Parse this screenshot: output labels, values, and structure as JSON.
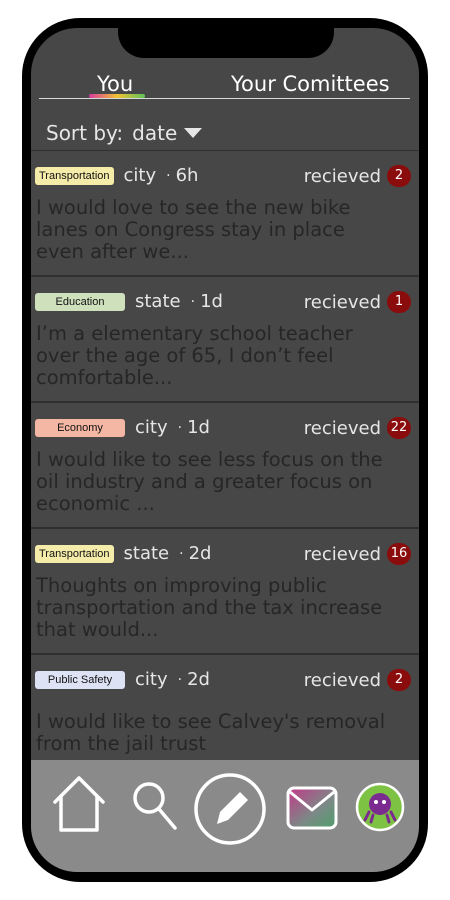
{
  "tabs": {
    "you": "You",
    "committees": "Your Comittees"
  },
  "sort": {
    "label": "Sort by:",
    "value": "date"
  },
  "messages": [
    {
      "tag": "Transportation",
      "tag_color": "#f5ecaa",
      "scope": "city",
      "age": "6h",
      "status": "recieved",
      "count": "2",
      "text": "I would love to see the new bike lanes on Congress stay in place even after we..."
    },
    {
      "tag": "Education",
      "tag_color": "#cfe0bd",
      "scope": "state",
      "age": "1d",
      "status": "recieved",
      "count": "1",
      "text": "I’m a elementary school teacher over the age of 65, I don’t feel comfortable..."
    },
    {
      "tag": "Economy",
      "tag_color": "#f4b7a3",
      "scope": "city",
      "age": "1d",
      "status": "recieved",
      "count": "22",
      "text": "I would like to see less focus on the oil industry and a greater focus on economic ..."
    },
    {
      "tag": "Transportation",
      "tag_color": "#f5ecaa",
      "scope": "state",
      "age": "2d",
      "status": "recieved",
      "count": "16",
      "text": "Thoughts on improving public transportation and the tax increase that would..."
    },
    {
      "tag": "Public Safety",
      "tag_color": "#dde3f5",
      "scope": "city",
      "age": "2d",
      "status": "recieved",
      "count": "2",
      "text": "I would like to see Calvey's removal from the jail trust"
    }
  ],
  "nav": {
    "icons": [
      "home-icon",
      "search-icon",
      "compose-icon",
      "mail-icon",
      "avatar-icon"
    ]
  },
  "colors": {
    "screen": "#474747",
    "nav": "#8a8a8a",
    "badge": "#8b0c0c"
  }
}
